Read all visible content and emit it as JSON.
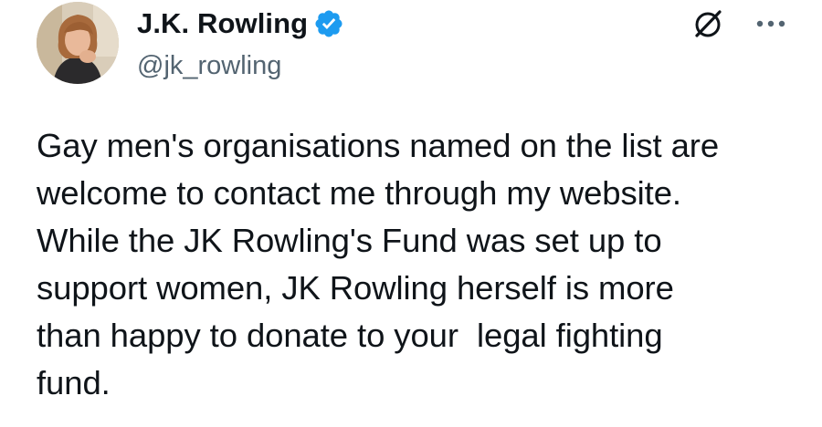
{
  "author": {
    "display_name": "J.K. Rowling",
    "handle": "@jk_rowling",
    "verified": true,
    "verified_color": "#1d9bf0"
  },
  "icons": {
    "avatar": "profile-photo",
    "verified": "verified-badge-icon",
    "grok": "grok-icon",
    "more": "more-options-icon"
  },
  "tweet": {
    "text": "Gay men's organisations named on the list are\nwelcome to contact me through my website.\nWhile the JK Rowling's Fund was set up to\nsupport women, JK Rowling herself is more\nthan happy to donate to your  legal fighting\nfund."
  }
}
